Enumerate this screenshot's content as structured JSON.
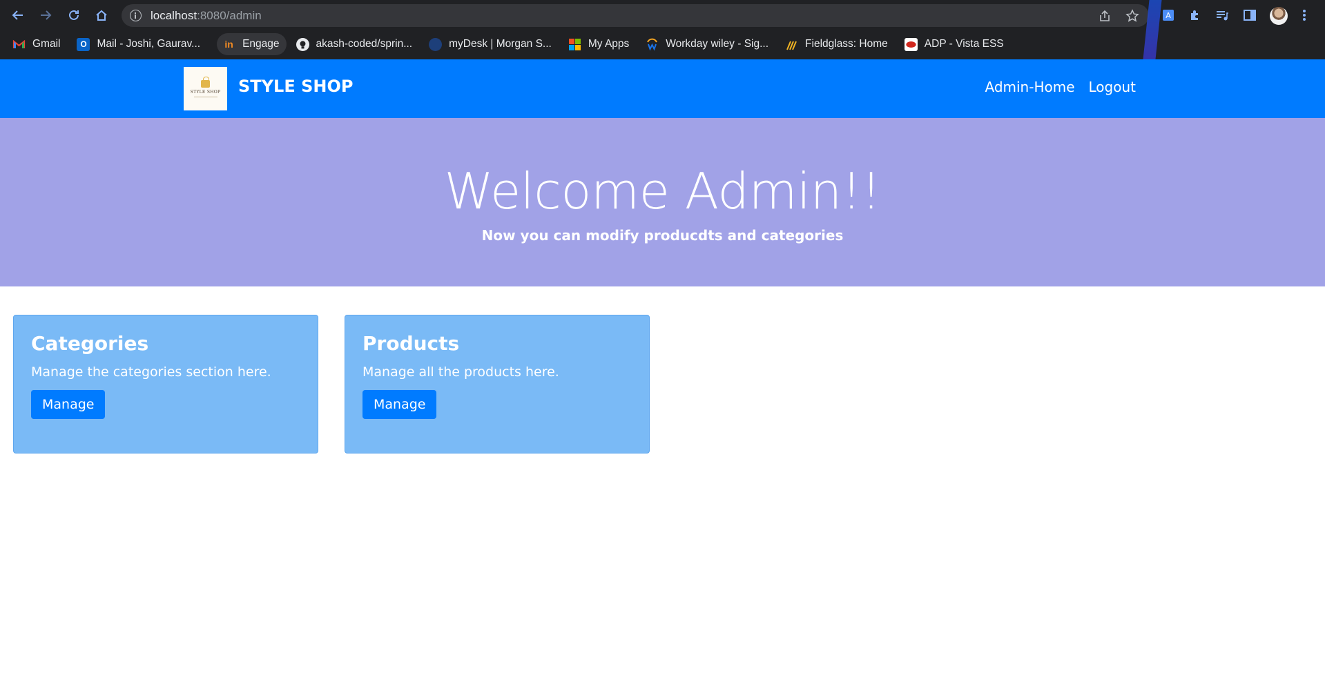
{
  "browser": {
    "url_host": "localhost",
    "url_path": ":8080/admin",
    "bookmarks": [
      {
        "label": "Gmail",
        "icon": "gmail-icon"
      },
      {
        "label": "Mail - Joshi, Gaurav...",
        "icon": "outlook-icon"
      },
      {
        "label": "Engage",
        "icon": "engage-icon"
      },
      {
        "label": "akash-coded/sprin...",
        "icon": "github-icon"
      },
      {
        "label": "myDesk | Morgan S...",
        "icon": "mydesk-icon"
      },
      {
        "label": "My Apps",
        "icon": "microsoft-icon"
      },
      {
        "label": "Workday wiley - Sig...",
        "icon": "workday-icon"
      },
      {
        "label": "Fieldglass: Home",
        "icon": "fieldglass-icon"
      },
      {
        "label": "ADP - Vista ESS",
        "icon": "adp-icon"
      }
    ]
  },
  "navbar": {
    "brand": "STYLE SHOP",
    "logo_text": "STYLE SHOP",
    "links": [
      {
        "label": "Admin-Home"
      },
      {
        "label": "Logout"
      }
    ]
  },
  "hero": {
    "title": "Welcome Admin!!",
    "lead": "Now you can modify producdts and categories"
  },
  "cards": [
    {
      "title": "Categories",
      "text": "Manage the categories section here.",
      "button": "Manage"
    },
    {
      "title": "Products",
      "text": "Manage all the products here.",
      "button": "Manage"
    }
  ],
  "colors": {
    "navbar": "#007bff",
    "hero": "#a1a2e7",
    "card": "#7abaf6",
    "button": "#007bff"
  }
}
